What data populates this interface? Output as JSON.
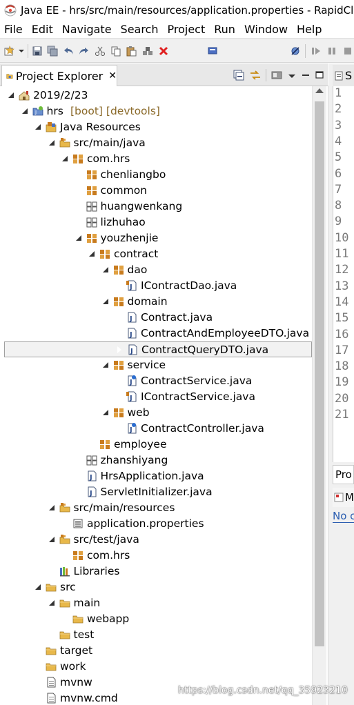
{
  "window": {
    "title": "Java EE - hrs/src/main/resources/application.properties - RapidClips"
  },
  "menu": [
    "File",
    "Edit",
    "Navigate",
    "Search",
    "Project",
    "Run",
    "Window",
    "Help"
  ],
  "project_explorer": {
    "tab_label": "Project Explorer",
    "close_glyph": "✕",
    "tree": [
      {
        "label": "2019/2/23",
        "depth": 0,
        "state": "open",
        "icon": "working-set-icon"
      },
      {
        "label": "hrs",
        "decoration": "[boot] [devtools]",
        "depth": 1,
        "state": "open",
        "icon": "project-icon"
      },
      {
        "label": "Java Resources",
        "depth": 2,
        "state": "open",
        "icon": "java-resources-icon"
      },
      {
        "label": "src/main/java",
        "depth": 3,
        "state": "open",
        "icon": "source-folder-icon"
      },
      {
        "label": "com.hrs",
        "depth": 4,
        "state": "open",
        "icon": "package-icon"
      },
      {
        "label": "chenliangbo",
        "depth": 5,
        "state": "closed",
        "icon": "package-icon"
      },
      {
        "label": "common",
        "depth": 5,
        "state": "closed",
        "icon": "package-icon"
      },
      {
        "label": "huangwenkang",
        "depth": 5,
        "state": "closed",
        "icon": "package-empty-icon"
      },
      {
        "label": "lizhuhao",
        "depth": 5,
        "state": "closed",
        "icon": "package-empty-icon"
      },
      {
        "label": "youzhenjie",
        "depth": 5,
        "state": "open",
        "icon": "package-icon"
      },
      {
        "label": "contract",
        "depth": 6,
        "state": "open",
        "icon": "package-icon"
      },
      {
        "label": "dao",
        "depth": 7,
        "state": "open",
        "icon": "package-icon"
      },
      {
        "label": "IContractDao.java",
        "depth": 8,
        "state": "closed",
        "icon": "interface-file-icon"
      },
      {
        "label": "domain",
        "depth": 7,
        "state": "open",
        "icon": "package-icon"
      },
      {
        "label": "Contract.java",
        "depth": 8,
        "state": "closed",
        "icon": "java-file-icon"
      },
      {
        "label": "ContractAndEmployeeDTO.java",
        "depth": 8,
        "state": "closed",
        "icon": "java-file-icon"
      },
      {
        "label": "ContractQueryDTO.java",
        "depth": 8,
        "state": "closed",
        "icon": "java-file-icon",
        "selected": true
      },
      {
        "label": "service",
        "depth": 7,
        "state": "open",
        "icon": "package-icon"
      },
      {
        "label": "ContractService.java",
        "depth": 8,
        "state": "closed",
        "icon": "spring-bean-file-icon"
      },
      {
        "label": "IContractService.java",
        "depth": 8,
        "state": "closed",
        "icon": "interface-file-icon"
      },
      {
        "label": "web",
        "depth": 7,
        "state": "open",
        "icon": "package-icon"
      },
      {
        "label": "ContractController.java",
        "depth": 8,
        "state": "closed",
        "icon": "spring-bean-file-icon"
      },
      {
        "label": "employee",
        "depth": 6,
        "state": "closed",
        "icon": "package-icon"
      },
      {
        "label": "zhanshiyang",
        "depth": 5,
        "state": "closed",
        "icon": "package-empty-icon"
      },
      {
        "label": "HrsApplication.java",
        "depth": 5,
        "state": "closed",
        "icon": "java-file-icon"
      },
      {
        "label": "ServletInitializer.java",
        "depth": 5,
        "state": "closed",
        "icon": "java-file-icon"
      },
      {
        "label": "src/main/resources",
        "depth": 3,
        "state": "open",
        "icon": "source-folder-icon"
      },
      {
        "label": "application.properties",
        "depth": 4,
        "state": "none",
        "icon": "properties-file-icon"
      },
      {
        "label": "src/test/java",
        "depth": 3,
        "state": "open",
        "icon": "source-folder-icon"
      },
      {
        "label": "com.hrs",
        "depth": 4,
        "state": "closed",
        "icon": "package-icon"
      },
      {
        "label": "Libraries",
        "depth": 3,
        "state": "closed",
        "icon": "libraries-icon"
      },
      {
        "label": "src",
        "depth": 2,
        "state": "open",
        "icon": "folder-icon"
      },
      {
        "label": "main",
        "depth": 3,
        "state": "open",
        "icon": "folder-icon"
      },
      {
        "label": "webapp",
        "depth": 4,
        "state": "closed",
        "icon": "folder-icon"
      },
      {
        "label": "test",
        "depth": 3,
        "state": "none",
        "icon": "folder-icon"
      },
      {
        "label": "target",
        "depth": 2,
        "state": "closed",
        "icon": "folder-icon"
      },
      {
        "label": "work",
        "depth": 2,
        "state": "closed",
        "icon": "folder-icon"
      },
      {
        "label": "mvnw",
        "depth": 2,
        "state": "none",
        "icon": "file-icon"
      },
      {
        "label": "mvnw.cmd",
        "depth": 2,
        "state": "none",
        "icon": "file-icon"
      }
    ]
  },
  "editor": {
    "tab_label": "S",
    "line_numbers": [
      "1",
      "2",
      "3",
      "4",
      "5",
      "6",
      "7",
      "8",
      "9",
      "10",
      "11",
      "12",
      "13",
      "14",
      "15",
      "16",
      "17",
      "18",
      "19",
      "20",
      "21"
    ]
  },
  "bottom_panel": {
    "problems_tab": "Pro",
    "markers_tab": "M",
    "no_content": "No c"
  },
  "watermark": "https://blog.csdn.net/qq_35923210",
  "colors": {
    "decoration": "#8b6a2a",
    "package_orange": "#c87b1e",
    "folder_yellow": "#e8b84a",
    "selection_border": "#a0a0a0",
    "link_blue": "#2a5db0"
  }
}
